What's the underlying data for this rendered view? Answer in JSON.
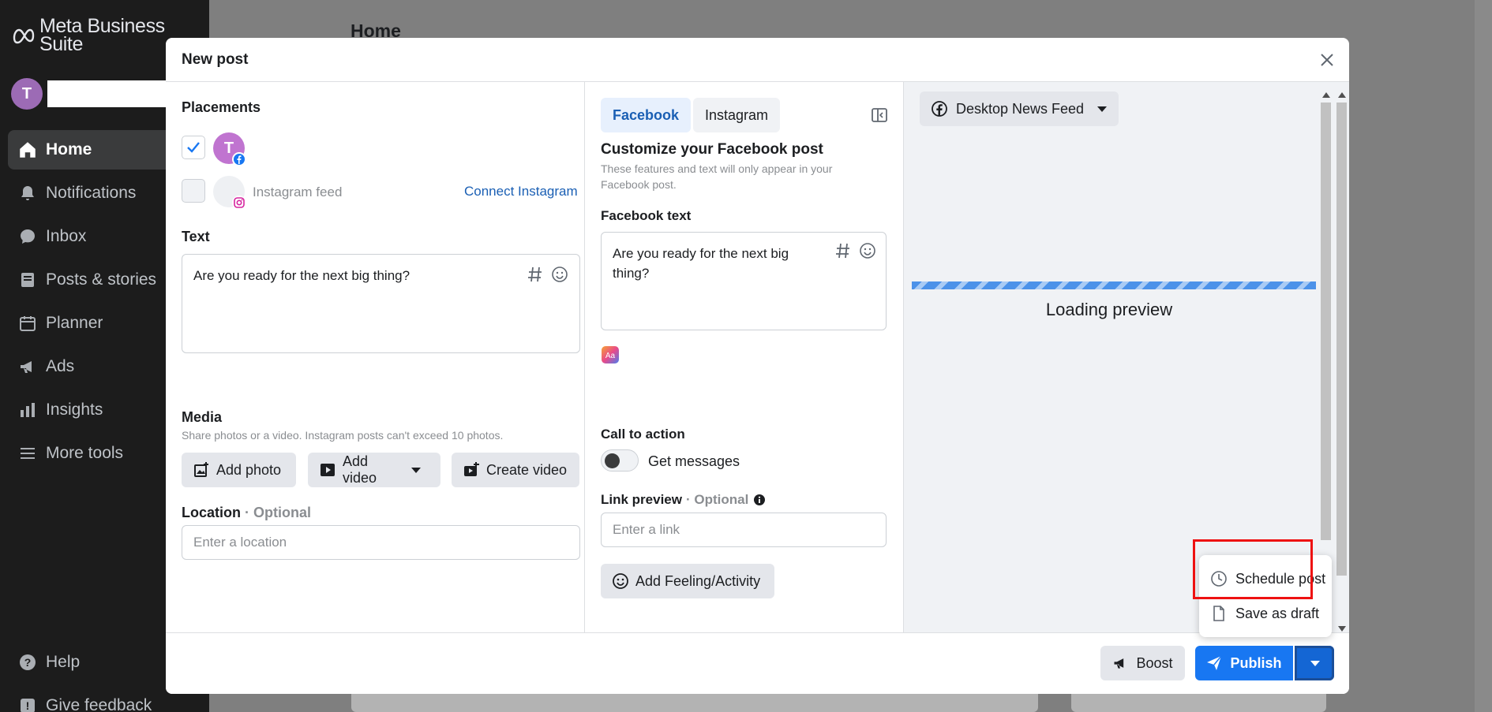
{
  "sidebar": {
    "logo": "Meta Business Suite",
    "account_initial": "T",
    "nav": [
      {
        "label": "Home",
        "icon": "home-icon"
      },
      {
        "label": "Notifications",
        "icon": "bell-icon"
      },
      {
        "label": "Inbox",
        "icon": "chat-bubble-icon"
      },
      {
        "label": "Posts & stories",
        "icon": "posts-icon"
      },
      {
        "label": "Planner",
        "icon": "calendar-icon"
      },
      {
        "label": "Ads",
        "icon": "megaphone-icon"
      },
      {
        "label": "Insights",
        "icon": "bar-chart-icon"
      },
      {
        "label": "More tools",
        "icon": "menu-lines-icon"
      }
    ],
    "help": "Help",
    "feedback": "Give feedback"
  },
  "background": {
    "page_title": "Home"
  },
  "modal": {
    "title": "New post",
    "placements": {
      "label": "Placements",
      "facebook_initial": "T",
      "instagram_label": "Instagram feed",
      "connect_instagram": "Connect Instagram"
    },
    "text": {
      "label": "Text",
      "value": "Are you ready for the next big thing?"
    },
    "media": {
      "label": "Media",
      "hint": "Share photos or a video. Instagram posts can't exceed 10 photos.",
      "add_photo": "Add photo",
      "add_video": "Add video",
      "create_video": "Create video"
    },
    "location": {
      "label": "Location",
      "optional": "· Optional",
      "placeholder": "Enter a location"
    },
    "customize": {
      "tabs": [
        "Facebook",
        "Instagram"
      ],
      "selected_tab": "Facebook",
      "heading": "Customize your Facebook post",
      "hint": "These features and text will only appear in your Facebook post.",
      "fb_text_label": "Facebook text",
      "fb_text_value": "Are you ready for the next big thing?",
      "cta_label": "Call to action",
      "cta_toggle": "Get messages",
      "link_label": "Link preview",
      "link_optional": "· Optional",
      "link_placeholder": "Enter a link",
      "feeling_button": "Add Feeling/Activity"
    },
    "preview": {
      "feed_select": "Desktop News Feed",
      "loading": "Loading preview"
    },
    "footer": {
      "boost": "Boost",
      "publish": "Publish"
    },
    "publish_menu": [
      "Schedule post",
      "Save as draft"
    ]
  },
  "colors": {
    "accent": "#1877f2",
    "highlight": "#e11111",
    "sidebar_bg": "#1c1c1c"
  }
}
